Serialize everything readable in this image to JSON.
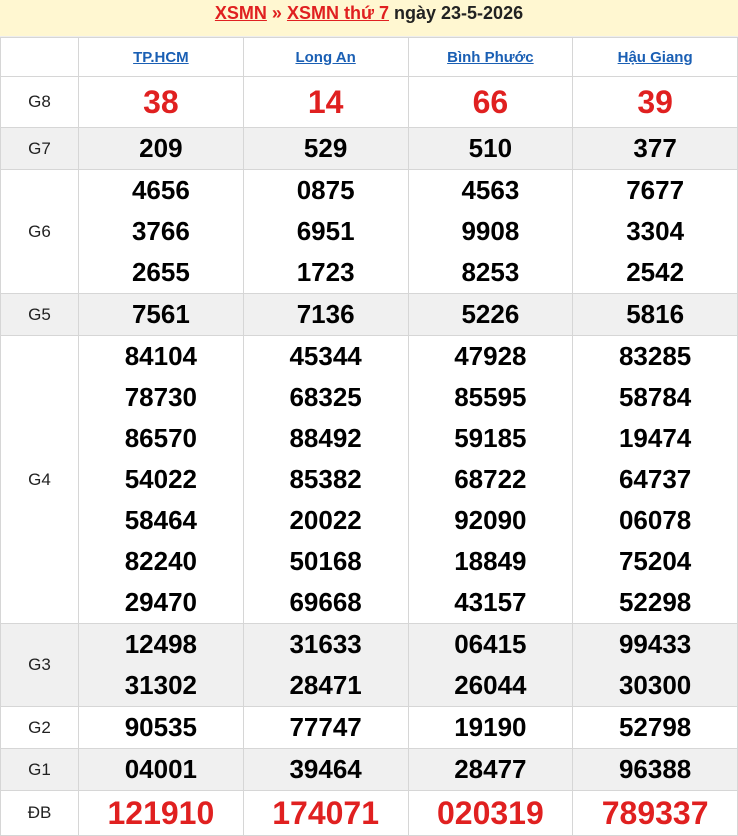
{
  "header": {
    "link1": "XSMN",
    "sep": "»",
    "link2": "XSMN thứ 7",
    "date_text": "ngày 23-5-2026"
  },
  "provinces": [
    "TP.HCM",
    "Long An",
    "Bình Phước",
    "Hậu Giang"
  ],
  "colors": {
    "red": "#e02020",
    "link": "#1a5fb4",
    "header_bg": "#fff7d1",
    "shade": "#f0f0f0"
  },
  "prizes": [
    {
      "label": "G8",
      "values": [
        [
          "38"
        ],
        [
          "14"
        ],
        [
          "66"
        ],
        [
          "39"
        ]
      ]
    },
    {
      "label": "G7",
      "values": [
        [
          "209"
        ],
        [
          "529"
        ],
        [
          "510"
        ],
        [
          "377"
        ]
      ]
    },
    {
      "label": "G6",
      "values": [
        [
          "4656",
          "3766",
          "2655"
        ],
        [
          "0875",
          "6951",
          "1723"
        ],
        [
          "4563",
          "9908",
          "8253"
        ],
        [
          "7677",
          "3304",
          "2542"
        ]
      ]
    },
    {
      "label": "G5",
      "values": [
        [
          "7561"
        ],
        [
          "7136"
        ],
        [
          "5226"
        ],
        [
          "5816"
        ]
      ]
    },
    {
      "label": "G4",
      "values": [
        [
          "84104",
          "78730",
          "86570",
          "54022",
          "58464",
          "82240",
          "29470"
        ],
        [
          "45344",
          "68325",
          "88492",
          "85382",
          "20022",
          "50168",
          "69668"
        ],
        [
          "47928",
          "85595",
          "59185",
          "68722",
          "92090",
          "18849",
          "43157"
        ],
        [
          "83285",
          "58784",
          "19474",
          "64737",
          "06078",
          "75204",
          "52298"
        ]
      ]
    },
    {
      "label": "G3",
      "values": [
        [
          "12498",
          "31302"
        ],
        [
          "31633",
          "28471"
        ],
        [
          "06415",
          "26044"
        ],
        [
          "99433",
          "30300"
        ]
      ]
    },
    {
      "label": "G2",
      "values": [
        [
          "90535"
        ],
        [
          "77747"
        ],
        [
          "19190"
        ],
        [
          "52798"
        ]
      ]
    },
    {
      "label": "G1",
      "values": [
        [
          "04001"
        ],
        [
          "39464"
        ],
        [
          "28477"
        ],
        [
          "96388"
        ]
      ]
    },
    {
      "label": "ĐB",
      "values": [
        [
          "121910"
        ],
        [
          "174071"
        ],
        [
          "020319"
        ],
        [
          "789337"
        ]
      ]
    }
  ]
}
